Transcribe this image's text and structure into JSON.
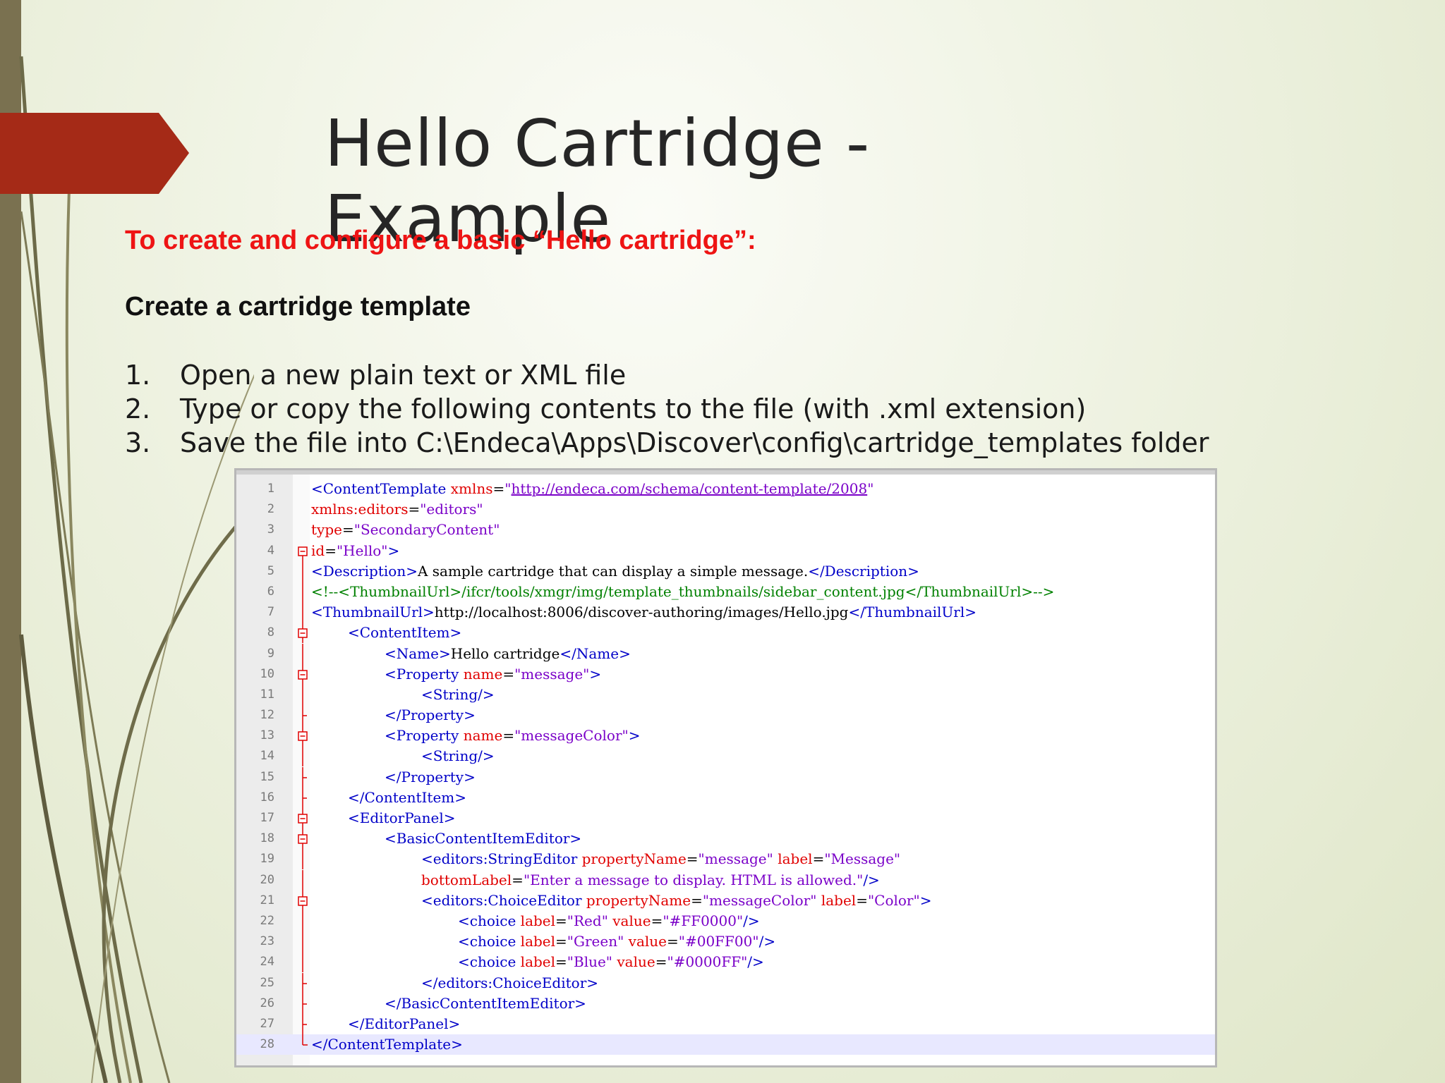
{
  "slide": {
    "title": "Hello Cartridge - Example",
    "subtitle": "To create and configure a basic “Hello cartridge”:",
    "heading": "Create a cartridge template",
    "steps": [
      {
        "num": "1.",
        "text": "Open a new plain text or XML file"
      },
      {
        "num": "2.",
        "text": "Type or copy the following contents to the file (with .xml extension)"
      },
      {
        "num": "3.",
        "text": "Save the file into C:\\Endeca\\Apps\\Discover\\config\\cartridge_templates folder"
      }
    ]
  },
  "colors": {
    "accent_arrow": "#a52a17",
    "subtitle_red": "#ee1414",
    "left_bar": "#7a7150"
  },
  "editor": {
    "active_line": 28,
    "lines": [
      {
        "n": "1",
        "fold": "",
        "indent": 0,
        "tokens": [
          [
            "tag",
            "<ContentTemplate "
          ],
          [
            "attr",
            "xmlns"
          ],
          [
            "plain",
            "="
          ],
          [
            "val",
            "\""
          ],
          [
            "url",
            "http://endeca.com/schema/content-template/2008"
          ],
          [
            "val",
            "\""
          ]
        ]
      },
      {
        "n": "2",
        "fold": "",
        "indent": 0,
        "tokens": [
          [
            "attr",
            "xmlns:editors"
          ],
          [
            "plain",
            "="
          ],
          [
            "val",
            "\"editors\""
          ]
        ]
      },
      {
        "n": "3",
        "fold": "",
        "indent": 0,
        "tokens": [
          [
            "attr",
            "type"
          ],
          [
            "plain",
            "="
          ],
          [
            "val",
            "\"SecondaryContent\""
          ]
        ]
      },
      {
        "n": "4",
        "fold": "box",
        "indent": 0,
        "tokens": [
          [
            "attr",
            "id"
          ],
          [
            "plain",
            "="
          ],
          [
            "val",
            "\"Hello\""
          ],
          [
            "tag",
            ">"
          ]
        ]
      },
      {
        "n": "5",
        "fold": "bar",
        "indent": 0,
        "tokens": [
          [
            "tag",
            "<Description>"
          ],
          [
            "plain",
            "A sample cartridge that can display a simple message."
          ],
          [
            "tag",
            "</Description>"
          ]
        ]
      },
      {
        "n": "6",
        "fold": "bar",
        "indent": 0,
        "tokens": [
          [
            "cmt",
            "<!--<ThumbnailUrl>/ifcr/tools/xmgr/img/template_thumbnails/sidebar_content.jpg</ThumbnailUrl>-->"
          ]
        ]
      },
      {
        "n": "7",
        "fold": "bar",
        "indent": 0,
        "tokens": [
          [
            "tag",
            "<ThumbnailUrl>"
          ],
          [
            "plain",
            "http://localhost:8006/discover-authoring/images/Hello.jpg"
          ],
          [
            "tag",
            "</ThumbnailUrl>"
          ]
        ]
      },
      {
        "n": "8",
        "fold": "box",
        "indent": 1,
        "tokens": [
          [
            "tag",
            "<ContentItem>"
          ]
        ]
      },
      {
        "n": "9",
        "fold": "bar",
        "indent": 2,
        "tokens": [
          [
            "tag",
            "<Name>"
          ],
          [
            "plain",
            "Hello cartridge"
          ],
          [
            "tag",
            "</Name>"
          ]
        ]
      },
      {
        "n": "10",
        "fold": "box",
        "indent": 2,
        "tokens": [
          [
            "tag",
            "<Property "
          ],
          [
            "attr",
            "name"
          ],
          [
            "plain",
            "="
          ],
          [
            "val",
            "\"message\""
          ],
          [
            "tag",
            ">"
          ]
        ]
      },
      {
        "n": "11",
        "fold": "bar",
        "indent": 3,
        "tokens": [
          [
            "tag",
            "<String/>"
          ]
        ]
      },
      {
        "n": "12",
        "fold": "end",
        "indent": 2,
        "tokens": [
          [
            "tag",
            "</Property>"
          ]
        ]
      },
      {
        "n": "13",
        "fold": "box",
        "indent": 2,
        "tokens": [
          [
            "tag",
            "<Property "
          ],
          [
            "attr",
            "name"
          ],
          [
            "plain",
            "="
          ],
          [
            "val",
            "\"messageColor\""
          ],
          [
            "tag",
            ">"
          ]
        ]
      },
      {
        "n": "14",
        "fold": "bar",
        "indent": 3,
        "tokens": [
          [
            "tag",
            "<String/>"
          ]
        ]
      },
      {
        "n": "15",
        "fold": "end",
        "indent": 2,
        "tokens": [
          [
            "tag",
            "</Property>"
          ]
        ]
      },
      {
        "n": "16",
        "fold": "end",
        "indent": 1,
        "tokens": [
          [
            "tag",
            "</ContentItem>"
          ]
        ]
      },
      {
        "n": "17",
        "fold": "box",
        "indent": 1,
        "tokens": [
          [
            "tag",
            "<EditorPanel>"
          ]
        ]
      },
      {
        "n": "18",
        "fold": "box",
        "indent": 2,
        "tokens": [
          [
            "tag",
            "<BasicContentItemEditor>"
          ]
        ]
      },
      {
        "n": "19",
        "fold": "bar",
        "indent": 3,
        "tokens": [
          [
            "tag",
            "<editors:StringEditor "
          ],
          [
            "attr",
            "propertyName"
          ],
          [
            "plain",
            "="
          ],
          [
            "val",
            "\"message\" "
          ],
          [
            "attr",
            "label"
          ],
          [
            "plain",
            "="
          ],
          [
            "val",
            "\"Message\""
          ]
        ]
      },
      {
        "n": "20",
        "fold": "bar",
        "indent": 3,
        "tokens": [
          [
            "attr",
            "bottomLabel"
          ],
          [
            "plain",
            "="
          ],
          [
            "val",
            "\"Enter a message to display. HTML is allowed.\""
          ],
          [
            "tag",
            "/>"
          ]
        ]
      },
      {
        "n": "21",
        "fold": "box",
        "indent": 3,
        "tokens": [
          [
            "tag",
            "<editors:ChoiceEditor "
          ],
          [
            "attr",
            "propertyName"
          ],
          [
            "plain",
            "="
          ],
          [
            "val",
            "\"messageColor\" "
          ],
          [
            "attr",
            "label"
          ],
          [
            "plain",
            "="
          ],
          [
            "val",
            "\"Color\""
          ],
          [
            "tag",
            ">"
          ]
        ]
      },
      {
        "n": "22",
        "fold": "bar",
        "indent": 4,
        "tokens": [
          [
            "tag",
            "<choice "
          ],
          [
            "attr",
            "label"
          ],
          [
            "plain",
            "="
          ],
          [
            "val",
            "\"Red\" "
          ],
          [
            "attr",
            "value"
          ],
          [
            "plain",
            "="
          ],
          [
            "val",
            "\"#FF0000\""
          ],
          [
            "tag",
            "/>"
          ]
        ]
      },
      {
        "n": "23",
        "fold": "bar",
        "indent": 4,
        "tokens": [
          [
            "tag",
            "<choice "
          ],
          [
            "attr",
            "label"
          ],
          [
            "plain",
            "="
          ],
          [
            "val",
            "\"Green\" "
          ],
          [
            "attr",
            "value"
          ],
          [
            "plain",
            "="
          ],
          [
            "val",
            "\"#00FF00\""
          ],
          [
            "tag",
            "/>"
          ]
        ]
      },
      {
        "n": "24",
        "fold": "bar",
        "indent": 4,
        "tokens": [
          [
            "tag",
            "<choice "
          ],
          [
            "attr",
            "label"
          ],
          [
            "plain",
            "="
          ],
          [
            "val",
            "\"Blue\" "
          ],
          [
            "attr",
            "value"
          ],
          [
            "plain",
            "="
          ],
          [
            "val",
            "\"#0000FF\""
          ],
          [
            "tag",
            "/>"
          ]
        ]
      },
      {
        "n": "25",
        "fold": "end",
        "indent": 3,
        "tokens": [
          [
            "tag",
            "</editors:ChoiceEditor>"
          ]
        ]
      },
      {
        "n": "26",
        "fold": "end",
        "indent": 2,
        "tokens": [
          [
            "tag",
            "</BasicContentItemEditor>"
          ]
        ]
      },
      {
        "n": "27",
        "fold": "end",
        "indent": 1,
        "tokens": [
          [
            "tag",
            "</EditorPanel>"
          ]
        ]
      },
      {
        "n": "28",
        "fold": "last",
        "indent": 0,
        "tokens": [
          [
            "tag",
            "</ContentTemplate>"
          ]
        ]
      }
    ]
  }
}
